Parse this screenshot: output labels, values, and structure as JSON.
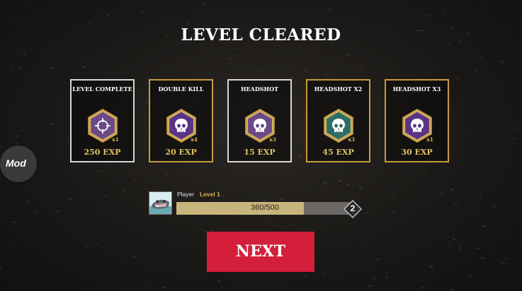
{
  "title": "LEVEL CLEARED",
  "rewards": [
    {
      "name": "LEVEL COMPLETE",
      "multiplier": "x1",
      "exp": "250 EXP",
      "icon": "crosshair-icon",
      "frame": "white",
      "badge_color": "#6b4a86"
    },
    {
      "name": "DOUBLE KILL",
      "multiplier": "x4",
      "exp": "20 EXP",
      "icon": "skull-icon",
      "frame": "gold",
      "badge_color": "#5a3486"
    },
    {
      "name": "HEADSHOT",
      "multiplier": "x3",
      "exp": "15 EXP",
      "icon": "skull-icon",
      "frame": "white",
      "badge_color": "#6b4a86"
    },
    {
      "name": "HEADSHOT X2",
      "multiplier": "x3",
      "exp": "45 EXP",
      "icon": "skull-icon",
      "frame": "gold",
      "badge_color": "#2f6d66"
    },
    {
      "name": "HEADSHOT X3",
      "multiplier": "x1",
      "exp": "30 EXP",
      "icon": "skull-icon",
      "frame": "gold",
      "badge_color": "#5a3486"
    }
  ],
  "mod_label": "Mod",
  "player": {
    "name": "Player",
    "level_label": "Level 1",
    "xp_text": "360/500",
    "xp_progress": 0.72,
    "next_level": "2",
    "avatar_icon": "shark-icon"
  },
  "next_button": "NEXT",
  "colors": {
    "gold": "#c89c3e",
    "exp_text": "#e2c165",
    "next_button": "#d41f3b",
    "xp_fill": "#c8b57c",
    "xp_track": "#6c6866"
  }
}
